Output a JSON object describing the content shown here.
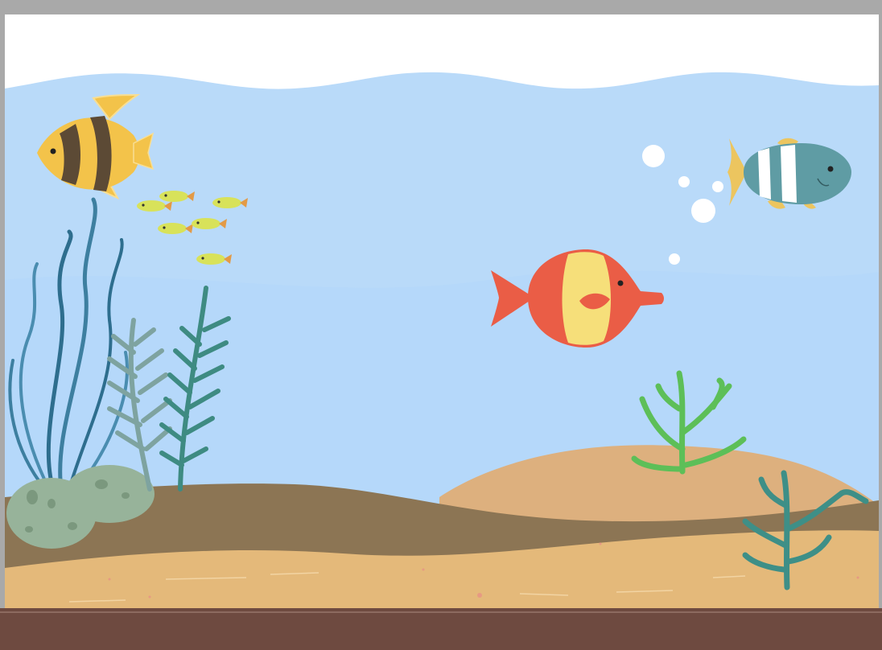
{
  "scene": {
    "colors": {
      "frame": "#a9a9a9",
      "water": "#b9daf9",
      "surface": "#ffffff",
      "sand_dark": "#8c7554",
      "sand_light": "#e4b97a",
      "dune": "#ddb07e",
      "stand": "#6e4a40"
    },
    "sprites": [
      {
        "name": "angelfish",
        "icon": "yellow-striped-angelfish"
      },
      {
        "name": "clownfish",
        "icon": "red-yellow-fish"
      },
      {
        "name": "bluefish",
        "icon": "teal-white-striped-fish"
      },
      {
        "name": "minnows",
        "icon": "small-yellow-fish-school",
        "count": 6
      },
      {
        "name": "bubbles",
        "icon": "bubble",
        "count": 5
      },
      {
        "name": "seaweed",
        "icon": "kelp"
      },
      {
        "name": "green-coral",
        "icon": "coral"
      },
      {
        "name": "teal-coral",
        "icon": "coral"
      },
      {
        "name": "rocks",
        "icon": "rock"
      }
    ]
  }
}
